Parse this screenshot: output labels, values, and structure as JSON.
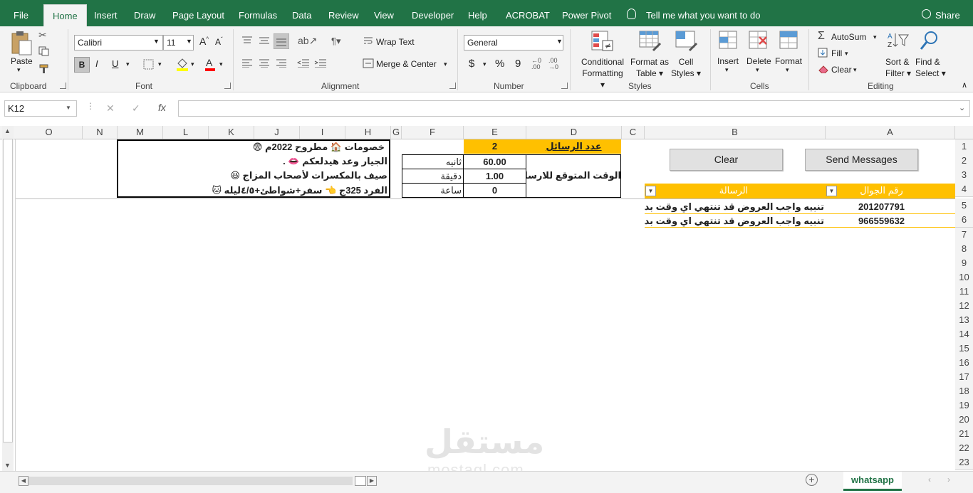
{
  "menu": {
    "tabs": [
      "File",
      "Home",
      "Insert",
      "Draw",
      "Page Layout",
      "Formulas",
      "Data",
      "Review",
      "View",
      "Developer",
      "Help",
      "ACROBAT",
      "Power Pivot"
    ],
    "tell_me": "Tell me what you want to do",
    "share": "Share"
  },
  "ribbon": {
    "clipboard": {
      "paste": "Paste",
      "label": "Clipboard"
    },
    "font": {
      "name": "Calibri",
      "size": "11",
      "bold": "B",
      "italic": "I",
      "underline": "U",
      "label": "Font"
    },
    "alignment": {
      "wrap_text": "Wrap Text",
      "merge_center": "Merge & Center",
      "label": "Alignment"
    },
    "number": {
      "format": "General",
      "currency": "$",
      "percent": "%",
      "comma": "9",
      "label": "Number"
    },
    "styles": {
      "conditional": [
        "Conditional",
        "Formatting"
      ],
      "format_as_table": [
        "Format as",
        "Table"
      ],
      "cell_styles": [
        "Cell",
        "Styles"
      ],
      "label": "Styles"
    },
    "cells": {
      "insert": "Insert",
      "delete": "Delete",
      "format": "Format",
      "label": "Cells"
    },
    "editing": {
      "autosum": "AutoSum",
      "fill": "Fill",
      "clear": "Clear",
      "sort": [
        "Sort &",
        "Filter"
      ],
      "find": [
        "Find &",
        "Select"
      ],
      "label": "Editing"
    }
  },
  "formula_bar": {
    "name_box": "K12",
    "cancel": "✕",
    "enter": "✓",
    "fx": "fx",
    "formula": ""
  },
  "columns": [
    "O",
    "N",
    "M",
    "L",
    "K",
    "J",
    "I",
    "H",
    "G",
    "F",
    "E",
    "D",
    "C",
    "B",
    "A"
  ],
  "rows": [
    "1",
    "2",
    "3",
    "4",
    "5",
    "6",
    "7",
    "8",
    "9",
    "10",
    "11",
    "12",
    "13",
    "14",
    "15",
    "16",
    "17",
    "18",
    "19",
    "20",
    "21",
    "22",
    "23"
  ],
  "sheet": {
    "message_box_lines": [
      "خصومات 🏠 مطروح 2022م 😨",
      "الجيار وعد هيدلعكم 👄 .",
      "صيف بالمكسرات لأصحاب المزاج 😆",
      "الفرد 325ج 👈 سفر+شواطئ+٤/٥ليله 🐱"
    ],
    "count_label": "عدد الرسائل",
    "count_value": "2",
    "expected_label": "الوقت المتوقع للارسال",
    "seconds_label": "ثانيه",
    "seconds_value": "60.00",
    "minutes_label": "دقيقة",
    "minutes_value": "1.00",
    "hours_label": "ساعة",
    "hours_value": "0",
    "clear_button": "Clear",
    "send_button": "Send Messages",
    "table_headers": {
      "phone": "رقم الجوال",
      "message": "الرسالة"
    },
    "table_rows": [
      {
        "phone": "201207791",
        "message": "تنبيه واجب العروض قد تنتهي اي وقت بدون اعلا"
      },
      {
        "phone": "966559632",
        "message": "تنبيه واجب العروض قد تنتهي اي وقت بدون اعلا"
      }
    ]
  },
  "sheet_tabs": {
    "active": "whatsapp"
  },
  "watermark": {
    "text": "مستقل",
    "domain": "mostaql.com"
  },
  "colors": {
    "excel_green": "#217346",
    "header_yellow": "#ffc000",
    "cell_yellow": "#ffe699"
  }
}
